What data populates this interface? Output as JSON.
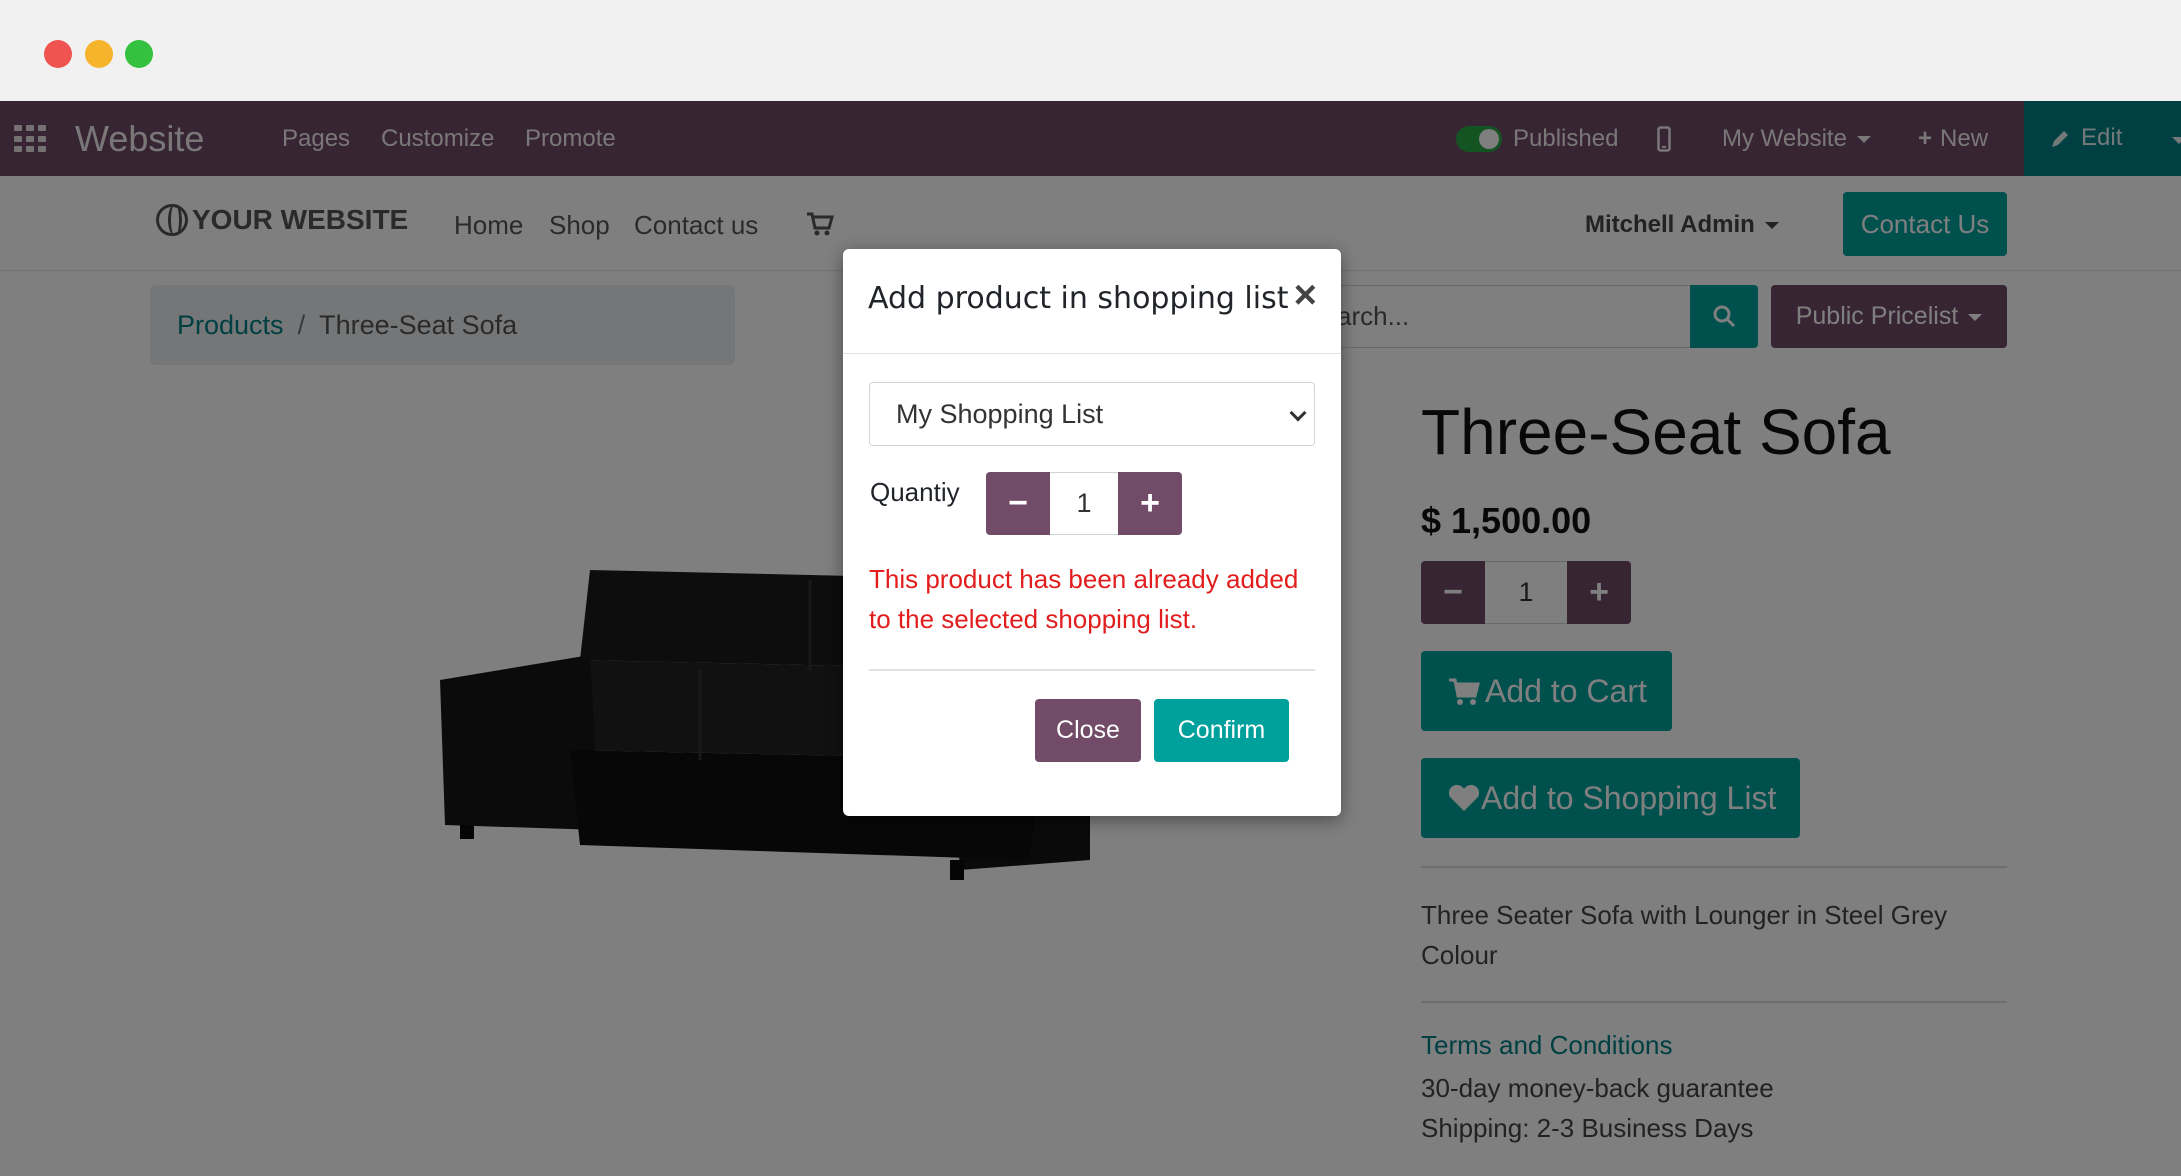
{
  "top_bar": {
    "brand": "Website",
    "menu": [
      "Pages",
      "Customize",
      "Promote"
    ],
    "published_label": "Published",
    "site_selector": "My Website",
    "new_label": "New",
    "edit_label": "Edit"
  },
  "header": {
    "logo_text": "YOUR WEBSITE",
    "nav": [
      "Home",
      "Shop",
      "Contact us"
    ],
    "user": "Mitchell Admin",
    "contact_button": "Contact Us"
  },
  "breadcrumb": {
    "parent": "Products",
    "separator": "/",
    "current": "Three-Seat Sofa"
  },
  "search": {
    "placeholder_visible": "arch...",
    "pricelist": "Public Pricelist"
  },
  "product": {
    "title": "Three-Seat Sofa",
    "price": "$ 1,500.00",
    "quantity": "1",
    "add_to_cart": "Add to Cart",
    "add_to_list": "Add to Shopping List",
    "description": "Three Seater Sofa with Lounger in Steel Grey Colour",
    "terms_link": "Terms and Conditions",
    "guarantee": "30-day money-back guarantee",
    "shipping": "Shipping: 2-3 Business Days"
  },
  "modal": {
    "title": "Add product in shopping list",
    "close_symbol": "×",
    "list_selected": "My Shopping List",
    "quantity_label": "Quantiy",
    "quantity_value": "1",
    "warning": "This product has been already added to the selected shopping list.",
    "close_button": "Close",
    "confirm_button": "Confirm"
  },
  "colors": {
    "primary": "#714b67",
    "accent": "#00a09d",
    "error": "#e11d1d"
  }
}
